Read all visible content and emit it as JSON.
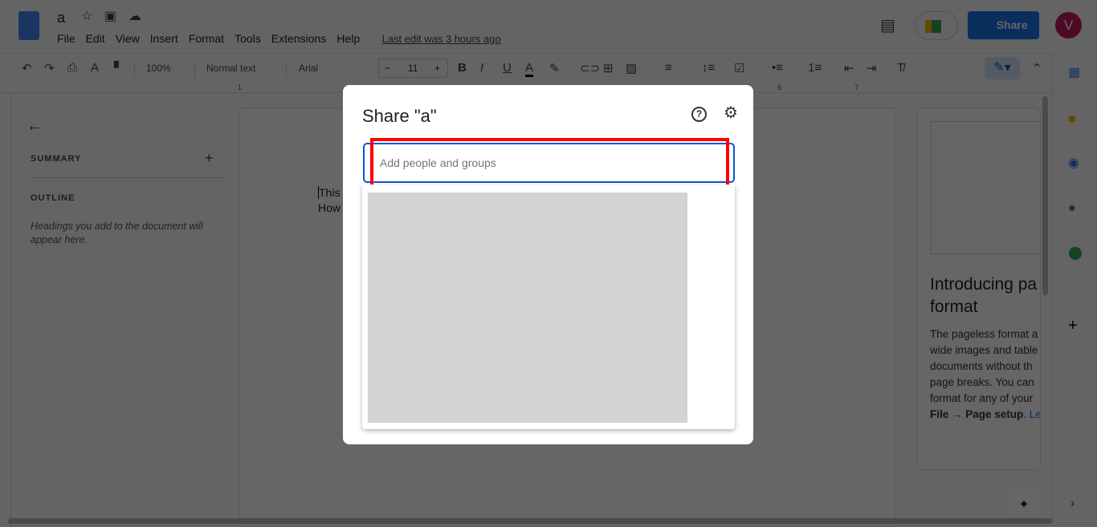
{
  "doc": {
    "title": "a",
    "menu": [
      "File",
      "Edit",
      "View",
      "Insert",
      "Format",
      "Tools",
      "Extensions",
      "Help"
    ],
    "last_edit": "Last edit was 3 hours ago",
    "share_label": "Share",
    "avatar": "V"
  },
  "toolbar": {
    "zoom": "100%",
    "style": "Normal text",
    "font": "Arial",
    "font_size": "11",
    "minus": "−",
    "plus": "+",
    "bold": "B",
    "italic": "I",
    "underline": "U",
    "text_color": "A"
  },
  "ruler": {
    "marks": [
      "1",
      "6",
      "7"
    ]
  },
  "sidebar": {
    "summary": "SUMMARY",
    "outline": "OUTLINE",
    "hint": "Headings you add to the document will appear here."
  },
  "body_text": [
    "This",
    "How"
  ],
  "promo": {
    "title": "Introducing pa format",
    "text": "The pageless format a wide images and table documents without th page breaks. You can format for any of your",
    "bold": "File → Page setup",
    "link": "Le"
  },
  "dialog": {
    "title": "Share \"a\"",
    "input_placeholder": "Add people and groups"
  },
  "colors": {
    "accent": "#0b57d0",
    "highlight": "#ff0000",
    "avatar": "#c2185b"
  }
}
